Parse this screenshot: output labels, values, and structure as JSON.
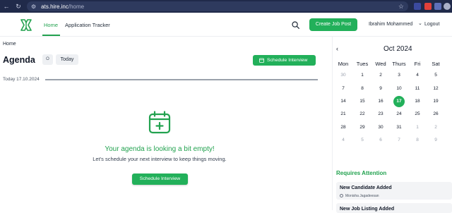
{
  "browser": {
    "url_host": "ats.hire.inc",
    "url_path": "/home",
    "extension_colors": [
      "#3b4a9e",
      "#e0403a",
      "#5d6fb8",
      "#aab1c9"
    ]
  },
  "header": {
    "nav": {
      "home": "Home",
      "tracker": "Application Tracker"
    },
    "create_button": "Create Job Post",
    "user_name": "Ibrahim Mohammed",
    "user_chevron": "⌄",
    "logout": "Logout"
  },
  "breadcrumb": "Home",
  "agenda": {
    "title": "Agenda",
    "circle_chip": "O",
    "today_button": "Today",
    "schedule_button": "Schedule Interview",
    "today_label": "Today 17.10.2024",
    "empty_title": "Your agenda is looking a bit empty!",
    "empty_subtitle": "Let's schedule your next interview to keep things moving.",
    "empty_button": "Schedule Interview"
  },
  "calendar": {
    "prev": "‹",
    "month": "Oct 2024",
    "weekdays": [
      "Mon",
      "Tues",
      "Wed",
      "Thurs",
      "Fri",
      "Sat"
    ],
    "weeks": [
      [
        "30",
        "1",
        "2",
        "3",
        "4",
        "5"
      ],
      [
        "7",
        "8",
        "9",
        "10",
        "11",
        "12"
      ],
      [
        "14",
        "15",
        "16",
        "17",
        "18",
        "19"
      ],
      [
        "21",
        "22",
        "23",
        "24",
        "25",
        "26"
      ],
      [
        "28",
        "29",
        "30",
        "31",
        "1",
        "2"
      ],
      [
        "4",
        "5",
        "6",
        "7",
        "8",
        "9"
      ]
    ],
    "outside": [
      [
        0,
        0
      ],
      [
        4,
        4
      ],
      [
        4,
        5
      ],
      [
        5,
        0
      ],
      [
        5,
        1
      ],
      [
        5,
        2
      ],
      [
        5,
        3
      ],
      [
        5,
        4
      ],
      [
        5,
        5
      ]
    ],
    "selected": [
      2,
      3
    ]
  },
  "attention": {
    "title": "Requires Attention",
    "cards": [
      {
        "title": "New Candidate Added",
        "person": "Monisha Jagadeesan"
      },
      {
        "title": "New Job Listing Added",
        "person": ""
      }
    ]
  },
  "colors": {
    "brand": "#22b05a",
    "brand_text": "#22a24f",
    "header_bg": "#202a4a"
  }
}
